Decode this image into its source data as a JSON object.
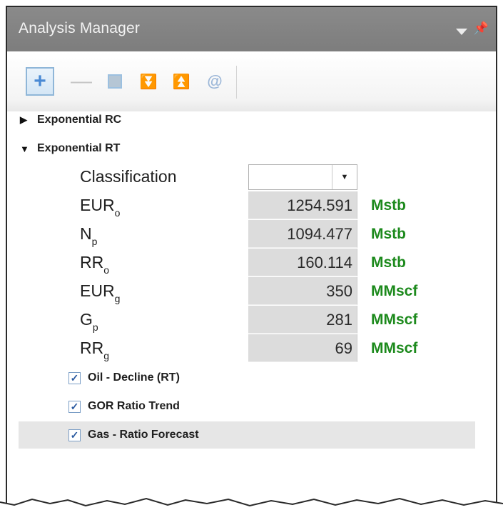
{
  "panel": {
    "title": "Analysis Manager",
    "menu_icon": "dropdown-triangle",
    "pin_icon": "pin"
  },
  "toolbar": {
    "buttons": [
      {
        "name": "add",
        "glyph": "+"
      },
      {
        "name": "remove",
        "glyph": "—"
      },
      {
        "name": "square",
        "glyph": ""
      },
      {
        "name": "move-down",
        "glyph": "⏬"
      },
      {
        "name": "move-up",
        "glyph": "⏫"
      },
      {
        "name": "at",
        "glyph": "@"
      }
    ]
  },
  "tree": {
    "nodes": [
      {
        "label": "Exponential RC",
        "expanded": false,
        "caret": "▶"
      },
      {
        "label": "Exponential RT",
        "expanded": true,
        "caret": "▼"
      }
    ],
    "classification": {
      "label": "Classification",
      "value": "",
      "arrow": "▼"
    },
    "rows": [
      {
        "base": "EUR",
        "sub": "o",
        "value": "1254.591",
        "unit": "Mstb"
      },
      {
        "base": "N",
        "sub": "p",
        "value": "1094.477",
        "unit": "Mstb"
      },
      {
        "base": "RR",
        "sub": "o",
        "value": "160.114",
        "unit": "Mstb"
      },
      {
        "base": "EUR",
        "sub": "g",
        "value": "350",
        "unit": "MMscf"
      },
      {
        "base": "G",
        "sub": "p",
        "value": "281",
        "unit": "MMscf"
      },
      {
        "base": "RR",
        "sub": "g",
        "value": "69",
        "unit": "MMscf"
      }
    ],
    "checks": [
      {
        "label": "Oil - Decline (RT)",
        "checked": true,
        "mark": "✓"
      },
      {
        "label": "GOR Ratio Trend",
        "checked": true,
        "mark": "✓"
      },
      {
        "label": "Gas - Ratio Forecast",
        "checked": true,
        "mark": "✓"
      }
    ]
  },
  "colors": {
    "unit_green": "#1d8a1d",
    "titlebar": "#808080",
    "value_cell": "#dcdcdc"
  }
}
